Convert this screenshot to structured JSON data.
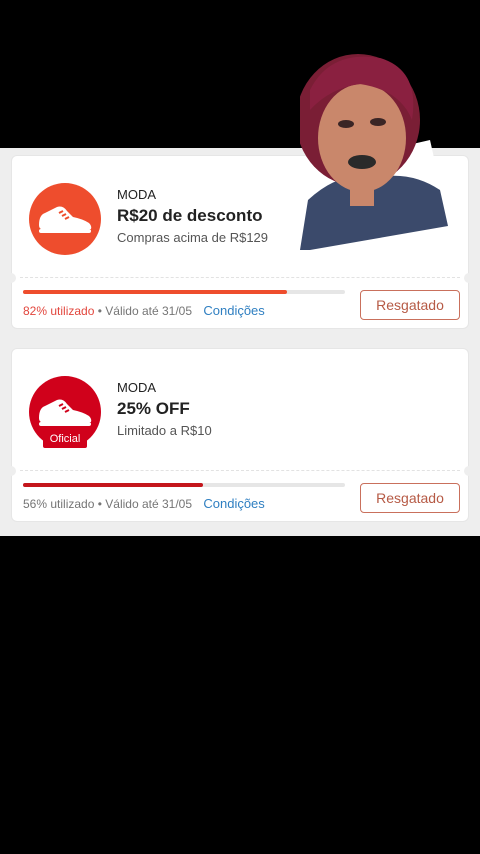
{
  "coupons": [
    {
      "category": "MODA",
      "title": "R$20 de desconto",
      "subtitle": "Compras acima de R$129",
      "usage_text": "82% utilizado",
      "usage_fraction": 0.82,
      "validity": "• Válido até 31/05",
      "conditions_label": "Condições",
      "button_label": "Resgatado",
      "logo_color": "#ee4d2d",
      "bar_color": "#ee4d2d"
    },
    {
      "category": "MODA",
      "title": "25% OFF",
      "subtitle": "Limitado a R$10",
      "badge_label": "Oficial",
      "usage_text": "56% utilizado",
      "usage_fraction": 0.56,
      "validity": "• Válido até 31/05",
      "conditions_label": "Condições",
      "button_label": "Resgatado",
      "logo_color": "#d0011b",
      "bar_color": "#c4161c"
    }
  ],
  "icons": [
    "sneaker-icon"
  ]
}
